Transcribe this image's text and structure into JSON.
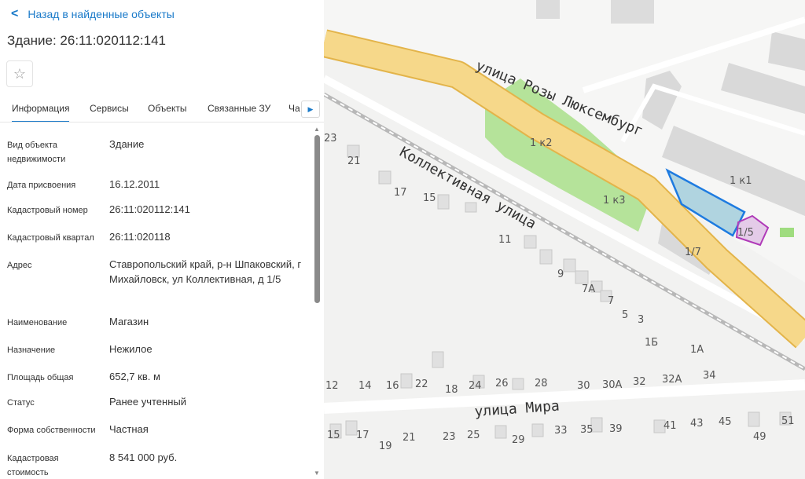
{
  "panel": {
    "back_label": "Назад в найденные объекты",
    "title": "Здание: 26:11:020112:141",
    "tabs": [
      {
        "label": "Информация",
        "active": true
      },
      {
        "label": "Сервисы"
      },
      {
        "label": "Объекты"
      },
      {
        "label": "Связанные ЗУ"
      },
      {
        "label": "Ча"
      }
    ],
    "fields": [
      {
        "label": "Вид объекта недвижимости",
        "value": "Здание"
      },
      {
        "label": "Дата присвоения",
        "value": "16.12.2011"
      },
      {
        "label": "Кадастровый номер",
        "value": "26:11:020112:141"
      },
      {
        "label": "Кадастровый квартал",
        "value": "26:11:020118"
      },
      {
        "label": "Адрес",
        "value": "Ставропольский край, р-н Шпаковский, г Михайловск, ул Коллективная, д 1/5"
      },
      {
        "label": "Наименование",
        "value": "Магазин"
      },
      {
        "label": "Назначение",
        "value": "Нежилое"
      },
      {
        "label": "Площадь общая",
        "value": "652,7 кв. м"
      },
      {
        "label": "Статус",
        "value": "Ранее учтенный"
      },
      {
        "label": "Форма собственности",
        "value": "Частная"
      },
      {
        "label": "Кадастровая стоимость",
        "value": "8 541 000 руб."
      }
    ]
  },
  "map": {
    "streets": {
      "rozy": "улица Розы Люксембург",
      "kollektivnaya": "Коллективная улица",
      "mira": "улица Мира"
    },
    "numbers": {
      "n25": "25",
      "n23": "23",
      "n21": "21",
      "n17": "17",
      "n15": "15",
      "k2": "1 к2",
      "k3": "1 к3",
      "k1": "1 к1",
      "n15sel": "1/5",
      "n17b": "1/7",
      "n11": "11",
      "n9": "9",
      "n7a": "7А",
      "n7": "7",
      "n5": "5",
      "n3": "3",
      "n1b": "1Б",
      "n1a": "1А",
      "n34": "34",
      "m12": "12",
      "m14": "14",
      "m16": "16",
      "m22": "22",
      "m18": "18",
      "m24": "24",
      "m26": "26",
      "m28": "28",
      "m30": "30",
      "m30a": "30А",
      "m32": "32",
      "m32a": "32А",
      "s15": "15",
      "s17": "17",
      "s19": "19",
      "s21": "21",
      "s23": "23",
      "s25": "25",
      "s29": "29",
      "s33": "33",
      "s35": "35",
      "s39": "39",
      "s41": "41",
      "s43": "43",
      "s45": "45",
      "s49": "49",
      "s51": "51"
    },
    "colors": {
      "road_major": "#f6d88a",
      "road_border": "#e3b44a",
      "park": "#a7dd8a",
      "building": "#dcdcdc",
      "selected_outline": "#1e7be0",
      "parcel_outline": "#b03ab8"
    }
  }
}
